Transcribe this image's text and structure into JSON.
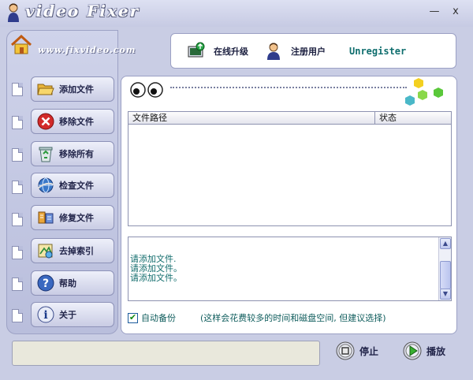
{
  "window": {
    "title_logo": "video Fixer",
    "minimize_glyph": "—",
    "close_glyph": "x"
  },
  "branding": {
    "url": "www.fixvideo.com",
    "home_icon": "home-icon"
  },
  "top_bar": {
    "online_upgrade_label": "在线升级",
    "register_label": "注册用户",
    "status_text": "Unregister"
  },
  "sidebar": {
    "items": [
      {
        "label": "添加文件",
        "icon": "folder-open-icon"
      },
      {
        "label": "移除文件",
        "icon": "remove-x-icon"
      },
      {
        "label": "移除所有",
        "icon": "recycle-bin-icon"
      },
      {
        "label": "检查文件",
        "icon": "check-globe-icon"
      },
      {
        "label": "修复文件",
        "icon": "repair-tools-icon"
      },
      {
        "label": "去掉索引",
        "icon": "remove-index-icon"
      },
      {
        "label": "帮助",
        "icon": "help-icon"
      },
      {
        "label": "关于",
        "icon": "info-icon"
      }
    ]
  },
  "file_table": {
    "columns": [
      "文件路径",
      "状态"
    ],
    "rows": []
  },
  "log": {
    "lines": [
      "请添加文件.",
      "请添加文件。",
      "请添加文件。"
    ]
  },
  "options": {
    "auto_backup_label": "自动备份",
    "auto_backup_checked": true,
    "auto_backup_check_glyph": "✔",
    "auto_backup_note": "(这样会花费较多的时间和磁盘空间, 但建议选择)"
  },
  "controls": {
    "stop_label": "停止",
    "play_label": "播放"
  },
  "colors": {
    "background": "#c9cde4",
    "log_text": "#116c6c",
    "unregister_text": "#0f6e6e"
  }
}
